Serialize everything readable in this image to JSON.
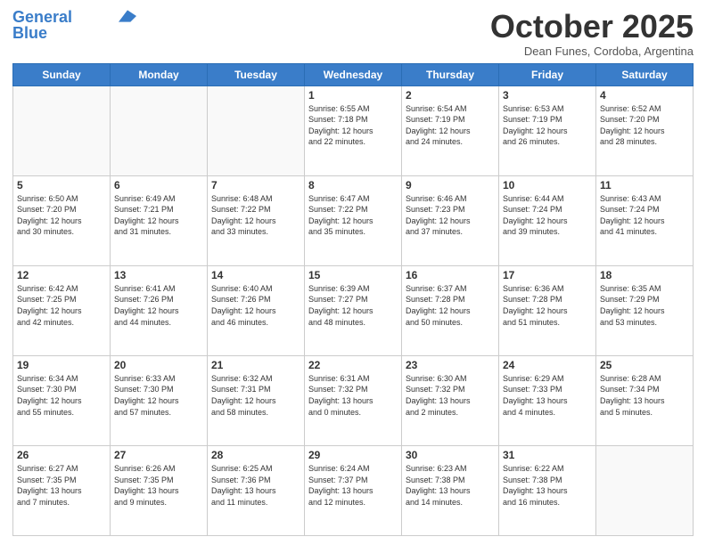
{
  "logo": {
    "line1": "General",
    "line2": "Blue"
  },
  "header": {
    "month": "October 2025",
    "location": "Dean Funes, Cordoba, Argentina"
  },
  "days_of_week": [
    "Sunday",
    "Monday",
    "Tuesday",
    "Wednesday",
    "Thursday",
    "Friday",
    "Saturday"
  ],
  "weeks": [
    [
      {
        "day": "",
        "info": ""
      },
      {
        "day": "",
        "info": ""
      },
      {
        "day": "",
        "info": ""
      },
      {
        "day": "1",
        "info": "Sunrise: 6:55 AM\nSunset: 7:18 PM\nDaylight: 12 hours\nand 22 minutes."
      },
      {
        "day": "2",
        "info": "Sunrise: 6:54 AM\nSunset: 7:19 PM\nDaylight: 12 hours\nand 24 minutes."
      },
      {
        "day": "3",
        "info": "Sunrise: 6:53 AM\nSunset: 7:19 PM\nDaylight: 12 hours\nand 26 minutes."
      },
      {
        "day": "4",
        "info": "Sunrise: 6:52 AM\nSunset: 7:20 PM\nDaylight: 12 hours\nand 28 minutes."
      }
    ],
    [
      {
        "day": "5",
        "info": "Sunrise: 6:50 AM\nSunset: 7:20 PM\nDaylight: 12 hours\nand 30 minutes."
      },
      {
        "day": "6",
        "info": "Sunrise: 6:49 AM\nSunset: 7:21 PM\nDaylight: 12 hours\nand 31 minutes."
      },
      {
        "day": "7",
        "info": "Sunrise: 6:48 AM\nSunset: 7:22 PM\nDaylight: 12 hours\nand 33 minutes."
      },
      {
        "day": "8",
        "info": "Sunrise: 6:47 AM\nSunset: 7:22 PM\nDaylight: 12 hours\nand 35 minutes."
      },
      {
        "day": "9",
        "info": "Sunrise: 6:46 AM\nSunset: 7:23 PM\nDaylight: 12 hours\nand 37 minutes."
      },
      {
        "day": "10",
        "info": "Sunrise: 6:44 AM\nSunset: 7:24 PM\nDaylight: 12 hours\nand 39 minutes."
      },
      {
        "day": "11",
        "info": "Sunrise: 6:43 AM\nSunset: 7:24 PM\nDaylight: 12 hours\nand 41 minutes."
      }
    ],
    [
      {
        "day": "12",
        "info": "Sunrise: 6:42 AM\nSunset: 7:25 PM\nDaylight: 12 hours\nand 42 minutes."
      },
      {
        "day": "13",
        "info": "Sunrise: 6:41 AM\nSunset: 7:26 PM\nDaylight: 12 hours\nand 44 minutes."
      },
      {
        "day": "14",
        "info": "Sunrise: 6:40 AM\nSunset: 7:26 PM\nDaylight: 12 hours\nand 46 minutes."
      },
      {
        "day": "15",
        "info": "Sunrise: 6:39 AM\nSunset: 7:27 PM\nDaylight: 12 hours\nand 48 minutes."
      },
      {
        "day": "16",
        "info": "Sunrise: 6:37 AM\nSunset: 7:28 PM\nDaylight: 12 hours\nand 50 minutes."
      },
      {
        "day": "17",
        "info": "Sunrise: 6:36 AM\nSunset: 7:28 PM\nDaylight: 12 hours\nand 51 minutes."
      },
      {
        "day": "18",
        "info": "Sunrise: 6:35 AM\nSunset: 7:29 PM\nDaylight: 12 hours\nand 53 minutes."
      }
    ],
    [
      {
        "day": "19",
        "info": "Sunrise: 6:34 AM\nSunset: 7:30 PM\nDaylight: 12 hours\nand 55 minutes."
      },
      {
        "day": "20",
        "info": "Sunrise: 6:33 AM\nSunset: 7:30 PM\nDaylight: 12 hours\nand 57 minutes."
      },
      {
        "day": "21",
        "info": "Sunrise: 6:32 AM\nSunset: 7:31 PM\nDaylight: 12 hours\nand 58 minutes."
      },
      {
        "day": "22",
        "info": "Sunrise: 6:31 AM\nSunset: 7:32 PM\nDaylight: 13 hours\nand 0 minutes."
      },
      {
        "day": "23",
        "info": "Sunrise: 6:30 AM\nSunset: 7:32 PM\nDaylight: 13 hours\nand 2 minutes."
      },
      {
        "day": "24",
        "info": "Sunrise: 6:29 AM\nSunset: 7:33 PM\nDaylight: 13 hours\nand 4 minutes."
      },
      {
        "day": "25",
        "info": "Sunrise: 6:28 AM\nSunset: 7:34 PM\nDaylight: 13 hours\nand 5 minutes."
      }
    ],
    [
      {
        "day": "26",
        "info": "Sunrise: 6:27 AM\nSunset: 7:35 PM\nDaylight: 13 hours\nand 7 minutes."
      },
      {
        "day": "27",
        "info": "Sunrise: 6:26 AM\nSunset: 7:35 PM\nDaylight: 13 hours\nand 9 minutes."
      },
      {
        "day": "28",
        "info": "Sunrise: 6:25 AM\nSunset: 7:36 PM\nDaylight: 13 hours\nand 11 minutes."
      },
      {
        "day": "29",
        "info": "Sunrise: 6:24 AM\nSunset: 7:37 PM\nDaylight: 13 hours\nand 12 minutes."
      },
      {
        "day": "30",
        "info": "Sunrise: 6:23 AM\nSunset: 7:38 PM\nDaylight: 13 hours\nand 14 minutes."
      },
      {
        "day": "31",
        "info": "Sunrise: 6:22 AM\nSunset: 7:38 PM\nDaylight: 13 hours\nand 16 minutes."
      },
      {
        "day": "",
        "info": ""
      }
    ]
  ]
}
